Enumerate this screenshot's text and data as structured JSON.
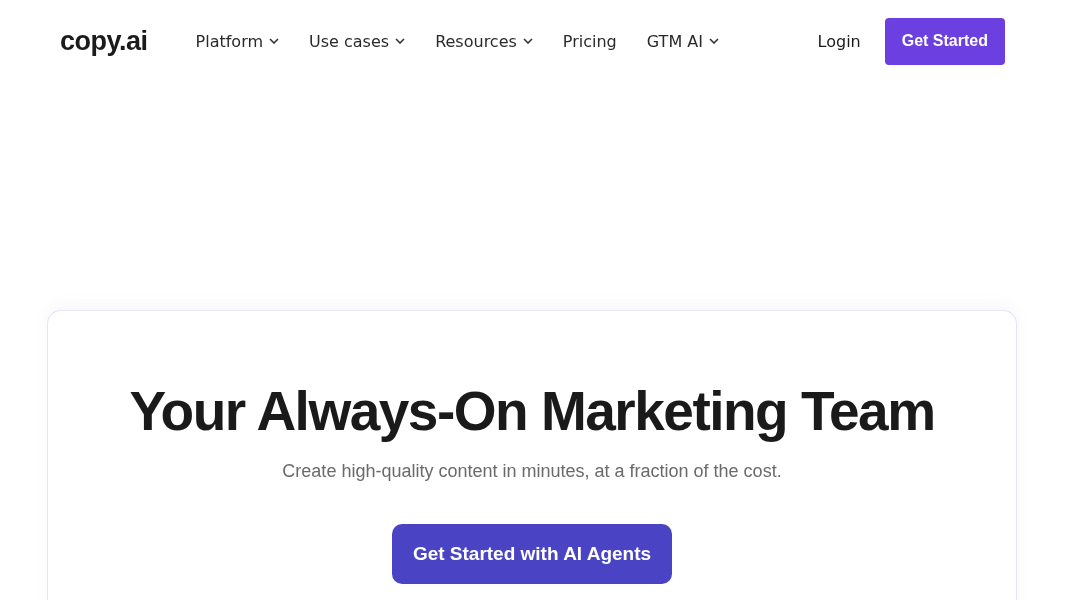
{
  "header": {
    "logo": "copy.ai",
    "nav": [
      {
        "label": "Platform",
        "has_menu": true
      },
      {
        "label": "Use cases",
        "has_menu": true
      },
      {
        "label": "Resources",
        "has_menu": true
      },
      {
        "label": "Pricing",
        "has_menu": false
      },
      {
        "label": "GTM AI",
        "has_menu": true
      }
    ],
    "login": "Login",
    "cta": "Get Started"
  },
  "hero": {
    "title": "Your Always-On Marketing Team",
    "subtitle": "Create high-quality content in minutes, at a fraction of the cost.",
    "cta": "Get Started with AI Agents"
  }
}
